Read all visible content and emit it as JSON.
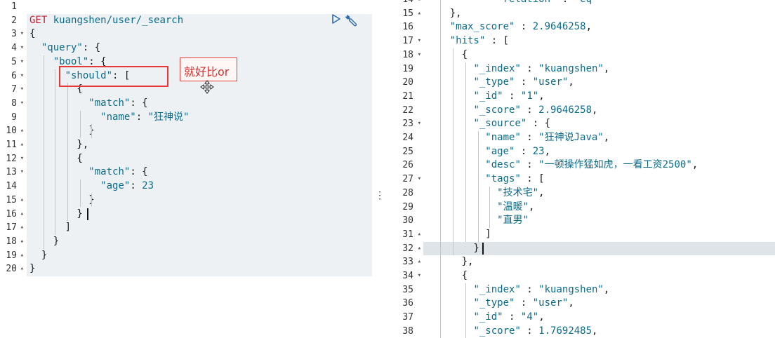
{
  "request": {
    "lines": [
      {
        "num": "1",
        "fold": "",
        "segs": []
      },
      {
        "num": "2",
        "fold": "",
        "segs": [
          {
            "t": "GET",
            "c": "m"
          },
          {
            "t": " kuangshen/user/_search",
            "c": "u"
          }
        ]
      },
      {
        "num": "3",
        "fold": "▾",
        "segs": [
          {
            "t": "{",
            "c": "p"
          }
        ]
      },
      {
        "num": "4",
        "fold": "▾",
        "segs": [
          {
            "t": "  ",
            "c": "p"
          },
          {
            "t": "\"query\"",
            "c": "k"
          },
          {
            "t": ": {",
            "c": "p"
          }
        ]
      },
      {
        "num": "5",
        "fold": "▾",
        "segs": [
          {
            "t": "    ",
            "c": "p"
          },
          {
            "t": "\"bool\"",
            "c": "k"
          },
          {
            "t": ": {",
            "c": "p"
          }
        ]
      },
      {
        "num": "6",
        "fold": "▾",
        "segs": [
          {
            "t": "      ",
            "c": "p"
          },
          {
            "t": "\"should\"",
            "c": "k"
          },
          {
            "t": ": [",
            "c": "p"
          }
        ]
      },
      {
        "num": "7",
        "fold": "▾",
        "segs": [
          {
            "t": "        {",
            "c": "p"
          }
        ]
      },
      {
        "num": "8",
        "fold": "▾",
        "segs": [
          {
            "t": "          ",
            "c": "p"
          },
          {
            "t": "\"match\"",
            "c": "k"
          },
          {
            "t": ": {",
            "c": "p"
          }
        ]
      },
      {
        "num": "9",
        "fold": "",
        "segs": [
          {
            "t": "            ",
            "c": "p"
          },
          {
            "t": "\"name\"",
            "c": "k"
          },
          {
            "t": ": ",
            "c": "p"
          },
          {
            "t": "\"狂神说\"",
            "c": "s"
          }
        ]
      },
      {
        "num": "10",
        "fold": "▴",
        "segs": [
          {
            "t": "          }",
            "c": "p"
          }
        ]
      },
      {
        "num": "11",
        "fold": "▴",
        "segs": [
          {
            "t": "        },",
            "c": "p"
          }
        ]
      },
      {
        "num": "12",
        "fold": "▾",
        "segs": [
          {
            "t": "        {",
            "c": "p"
          }
        ]
      },
      {
        "num": "13",
        "fold": "▾",
        "segs": [
          {
            "t": "          ",
            "c": "p"
          },
          {
            "t": "\"match\"",
            "c": "k"
          },
          {
            "t": ": {",
            "c": "p"
          }
        ]
      },
      {
        "num": "14",
        "fold": "",
        "segs": [
          {
            "t": "            ",
            "c": "p"
          },
          {
            "t": "\"age\"",
            "c": "k"
          },
          {
            "t": ": ",
            "c": "p"
          },
          {
            "t": "23",
            "c": "n"
          }
        ]
      },
      {
        "num": "15",
        "fold": "▴",
        "segs": [
          {
            "t": "          }",
            "c": "p"
          }
        ]
      },
      {
        "num": "16",
        "fold": "▴",
        "segs": [
          {
            "t": "        }",
            "c": "p"
          }
        ]
      },
      {
        "num": "17",
        "fold": "▴",
        "segs": [
          {
            "t": "      ]",
            "c": "p"
          }
        ]
      },
      {
        "num": "18",
        "fold": "▴",
        "segs": [
          {
            "t": "    }",
            "c": "p"
          }
        ]
      },
      {
        "num": "19",
        "fold": "▴",
        "segs": [
          {
            "t": "  }",
            "c": "p"
          }
        ]
      },
      {
        "num": "20",
        "fold": "▴",
        "segs": [
          {
            "t": "}",
            "c": "p"
          }
        ]
      }
    ]
  },
  "response": {
    "lines": [
      {
        "num": "14",
        "fold": "▴",
        "segs": [
          {
            "t": "            ",
            "c": "p"
          },
          {
            "t": "\"relation\"",
            "c": "k"
          },
          {
            "t": " : ",
            "c": "p"
          },
          {
            "t": "\"eq\"",
            "c": "s"
          }
        ]
      },
      {
        "num": "15",
        "fold": "▴",
        "segs": [
          {
            "t": "    },",
            "c": "p"
          }
        ]
      },
      {
        "num": "16",
        "fold": "",
        "segs": [
          {
            "t": "    ",
            "c": "p"
          },
          {
            "t": "\"max_score\"",
            "c": "k"
          },
          {
            "t": " : ",
            "c": "p"
          },
          {
            "t": "2.9646258",
            "c": "n"
          },
          {
            "t": ",",
            "c": "p"
          }
        ]
      },
      {
        "num": "17",
        "fold": "▾",
        "segs": [
          {
            "t": "    ",
            "c": "p"
          },
          {
            "t": "\"hits\"",
            "c": "k"
          },
          {
            "t": " : [",
            "c": "p"
          }
        ]
      },
      {
        "num": "18",
        "fold": "▾",
        "segs": [
          {
            "t": "      {",
            "c": "p"
          }
        ]
      },
      {
        "num": "19",
        "fold": "",
        "segs": [
          {
            "t": "        ",
            "c": "p"
          },
          {
            "t": "\"_index\"",
            "c": "k"
          },
          {
            "t": " : ",
            "c": "p"
          },
          {
            "t": "\"kuangshen\"",
            "c": "s"
          },
          {
            "t": ",",
            "c": "p"
          }
        ]
      },
      {
        "num": "20",
        "fold": "",
        "segs": [
          {
            "t": "        ",
            "c": "p"
          },
          {
            "t": "\"_type\"",
            "c": "k"
          },
          {
            "t": " : ",
            "c": "p"
          },
          {
            "t": "\"user\"",
            "c": "s"
          },
          {
            "t": ",",
            "c": "p"
          }
        ]
      },
      {
        "num": "21",
        "fold": "",
        "segs": [
          {
            "t": "        ",
            "c": "p"
          },
          {
            "t": "\"_id\"",
            "c": "k"
          },
          {
            "t": " : ",
            "c": "p"
          },
          {
            "t": "\"1\"",
            "c": "s"
          },
          {
            "t": ",",
            "c": "p"
          }
        ]
      },
      {
        "num": "22",
        "fold": "",
        "segs": [
          {
            "t": "        ",
            "c": "p"
          },
          {
            "t": "\"_score\"",
            "c": "k"
          },
          {
            "t": " : ",
            "c": "p"
          },
          {
            "t": "2.9646258",
            "c": "n"
          },
          {
            "t": ",",
            "c": "p"
          }
        ]
      },
      {
        "num": "23",
        "fold": "▾",
        "segs": [
          {
            "t": "        ",
            "c": "p"
          },
          {
            "t": "\"_source\"",
            "c": "k"
          },
          {
            "t": " : {",
            "c": "p"
          }
        ]
      },
      {
        "num": "24",
        "fold": "",
        "segs": [
          {
            "t": "          ",
            "c": "p"
          },
          {
            "t": "\"name\"",
            "c": "k"
          },
          {
            "t": " : ",
            "c": "p"
          },
          {
            "t": "\"狂神说Java\"",
            "c": "s"
          },
          {
            "t": ",",
            "c": "p"
          }
        ]
      },
      {
        "num": "25",
        "fold": "",
        "segs": [
          {
            "t": "          ",
            "c": "p"
          },
          {
            "t": "\"age\"",
            "c": "k"
          },
          {
            "t": " : ",
            "c": "p"
          },
          {
            "t": "23",
            "c": "n"
          },
          {
            "t": ",",
            "c": "p"
          }
        ]
      },
      {
        "num": "26",
        "fold": "",
        "segs": [
          {
            "t": "          ",
            "c": "p"
          },
          {
            "t": "\"desc\"",
            "c": "k"
          },
          {
            "t": " : ",
            "c": "p"
          },
          {
            "t": "\"一顿操作猛如虎，一看工资2500\"",
            "c": "s"
          },
          {
            "t": ",",
            "c": "p"
          }
        ]
      },
      {
        "num": "27",
        "fold": "▾",
        "segs": [
          {
            "t": "          ",
            "c": "p"
          },
          {
            "t": "\"tags\"",
            "c": "k"
          },
          {
            "t": " : [",
            "c": "p"
          }
        ]
      },
      {
        "num": "28",
        "fold": "",
        "segs": [
          {
            "t": "            ",
            "c": "p"
          },
          {
            "t": "\"技术宅\"",
            "c": "s"
          },
          {
            "t": ",",
            "c": "p"
          }
        ]
      },
      {
        "num": "29",
        "fold": "",
        "segs": [
          {
            "t": "            ",
            "c": "p"
          },
          {
            "t": "\"温暖\"",
            "c": "s"
          },
          {
            "t": ",",
            "c": "p"
          }
        ]
      },
      {
        "num": "30",
        "fold": "",
        "segs": [
          {
            "t": "            ",
            "c": "p"
          },
          {
            "t": "\"直男\"",
            "c": "s"
          }
        ]
      },
      {
        "num": "31",
        "fold": "▴",
        "segs": [
          {
            "t": "          ]",
            "c": "p"
          }
        ]
      },
      {
        "num": "32",
        "fold": "▴",
        "segs": [
          {
            "t": "        }",
            "c": "p"
          }
        ]
      },
      {
        "num": "33",
        "fold": "▴",
        "segs": [
          {
            "t": "      },",
            "c": "p"
          }
        ]
      },
      {
        "num": "34",
        "fold": "▾",
        "segs": [
          {
            "t": "      {",
            "c": "p"
          }
        ]
      },
      {
        "num": "35",
        "fold": "",
        "segs": [
          {
            "t": "        ",
            "c": "p"
          },
          {
            "t": "\"_index\"",
            "c": "k"
          },
          {
            "t": " : ",
            "c": "p"
          },
          {
            "t": "\"kuangshen\"",
            "c": "s"
          },
          {
            "t": ",",
            "c": "p"
          }
        ]
      },
      {
        "num": "36",
        "fold": "",
        "segs": [
          {
            "t": "        ",
            "c": "p"
          },
          {
            "t": "\"_type\"",
            "c": "k"
          },
          {
            "t": " : ",
            "c": "p"
          },
          {
            "t": "\"user\"",
            "c": "s"
          },
          {
            "t": ",",
            "c": "p"
          }
        ]
      },
      {
        "num": "37",
        "fold": "",
        "segs": [
          {
            "t": "        ",
            "c": "p"
          },
          {
            "t": "\"_id\"",
            "c": "k"
          },
          {
            "t": " : ",
            "c": "p"
          },
          {
            "t": "\"4\"",
            "c": "s"
          },
          {
            "t": ",",
            "c": "p"
          }
        ]
      },
      {
        "num": "38",
        "fold": "",
        "segs": [
          {
            "t": "        ",
            "c": "p"
          },
          {
            "t": "\"_score\"",
            "c": "k"
          },
          {
            "t": " : ",
            "c": "p"
          },
          {
            "t": "1.7692485",
            "c": "n"
          },
          {
            "t": ",",
            "c": "p"
          }
        ]
      }
    ]
  },
  "annotation": {
    "text": "就好比or"
  },
  "toolbar": {
    "run_icon": "play-icon",
    "settings_icon": "wrench-icon"
  },
  "divider": {
    "handle": "⋮"
  },
  "colors": {
    "method": "#c01f2f",
    "key": "#0b6b8a",
    "annotation": "#e53935",
    "request_bg": "#eef1f4",
    "active_line": "#dfe4e8"
  }
}
